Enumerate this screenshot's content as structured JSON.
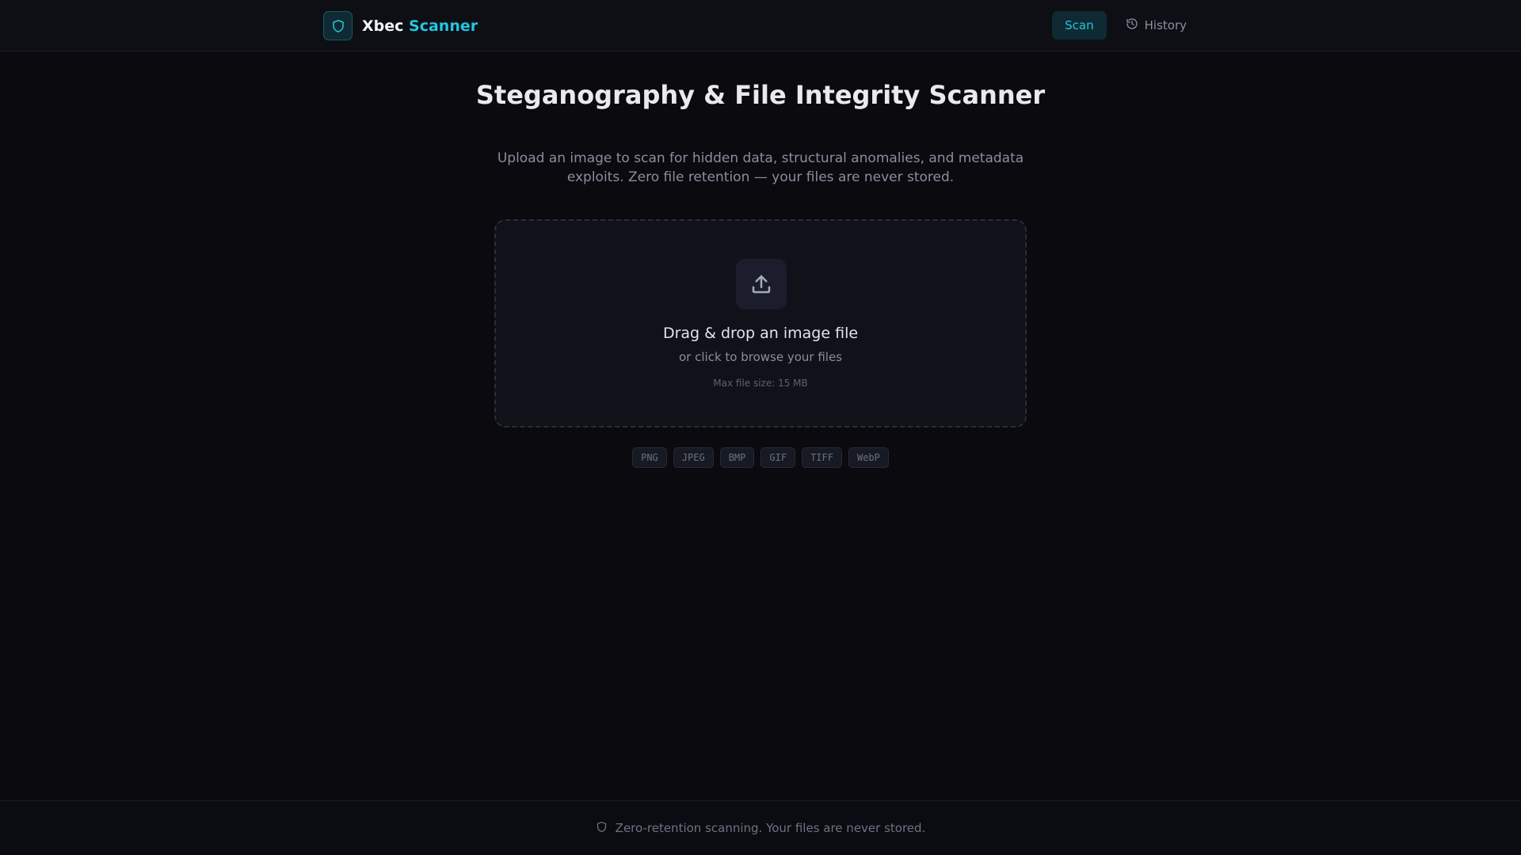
{
  "header": {
    "brand_name": "Xbec",
    "brand_accent": "Scanner",
    "nav": {
      "scan_label": "Scan",
      "history_label": "History"
    }
  },
  "hero": {
    "title": "Steganography & File Integrity Scanner",
    "subtitle": "Upload an image to scan for hidden data, structural anomalies, and metadata exploits. Zero file retention — your files are never stored."
  },
  "dropzone": {
    "title": "Drag & drop an image file",
    "subtitle": "or click to browse your files",
    "max_size": "Max file size: 15 MB"
  },
  "formats": [
    "PNG",
    "JPEG",
    "BMP",
    "GIF",
    "TIFF",
    "WebP"
  ],
  "footer": {
    "text": "Zero-retention scanning. Your files are never stored."
  },
  "icons": {
    "brand": "shield-icon",
    "history": "history-icon",
    "upload": "upload-icon",
    "footer": "shield-icon"
  },
  "colors": {
    "accent": "#22c7e0",
    "background": "#0a0a0f",
    "surface": "#101219"
  }
}
